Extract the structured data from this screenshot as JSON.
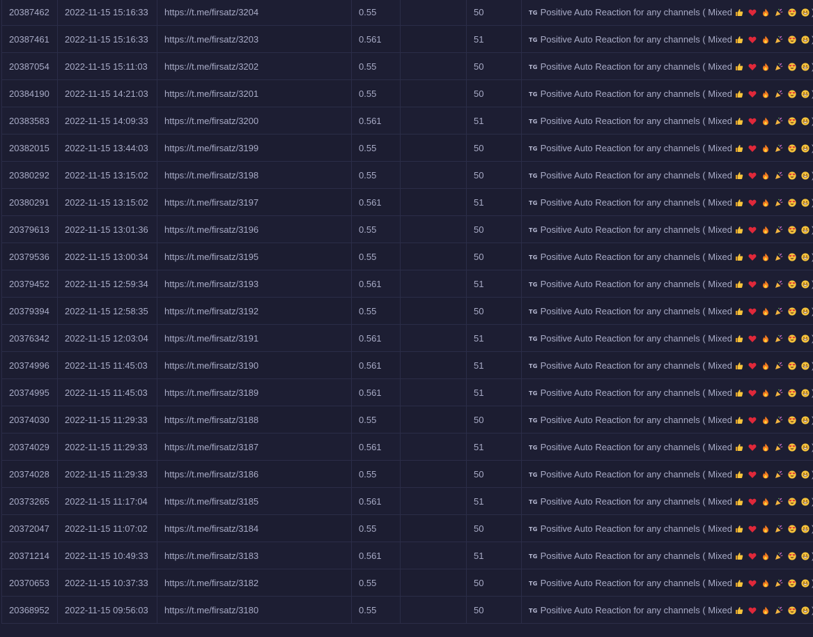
{
  "service_badge": "TG",
  "service_text": "Positive Auto Reaction for any channels ( Mixed",
  "service_close": ")",
  "emoji_icons": [
    "thumbs-up-icon",
    "heart-icon",
    "fire-icon",
    "party-popper-icon",
    "heart-eyes-icon",
    "grin-icon"
  ],
  "rows": [
    {
      "id": "20387462",
      "date": "2022-11-15 15:16:33",
      "link": "https://t.me/firsatz/3204",
      "charge": "0.55",
      "start_count": "",
      "quantity": "50"
    },
    {
      "id": "20387461",
      "date": "2022-11-15 15:16:33",
      "link": "https://t.me/firsatz/3203",
      "charge": "0.561",
      "start_count": "",
      "quantity": "51"
    },
    {
      "id": "20387054",
      "date": "2022-11-15 15:11:03",
      "link": "https://t.me/firsatz/3202",
      "charge": "0.55",
      "start_count": "",
      "quantity": "50"
    },
    {
      "id": "20384190",
      "date": "2022-11-15 14:21:03",
      "link": "https://t.me/firsatz/3201",
      "charge": "0.55",
      "start_count": "",
      "quantity": "50"
    },
    {
      "id": "20383583",
      "date": "2022-11-15 14:09:33",
      "link": "https://t.me/firsatz/3200",
      "charge": "0.561",
      "start_count": "",
      "quantity": "51"
    },
    {
      "id": "20382015",
      "date": "2022-11-15 13:44:03",
      "link": "https://t.me/firsatz/3199",
      "charge": "0.55",
      "start_count": "",
      "quantity": "50"
    },
    {
      "id": "20380292",
      "date": "2022-11-15 13:15:02",
      "link": "https://t.me/firsatz/3198",
      "charge": "0.55",
      "start_count": "",
      "quantity": "50"
    },
    {
      "id": "20380291",
      "date": "2022-11-15 13:15:02",
      "link": "https://t.me/firsatz/3197",
      "charge": "0.561",
      "start_count": "",
      "quantity": "51"
    },
    {
      "id": "20379613",
      "date": "2022-11-15 13:01:36",
      "link": "https://t.me/firsatz/3196",
      "charge": "0.55",
      "start_count": "",
      "quantity": "50"
    },
    {
      "id": "20379536",
      "date": "2022-11-15 13:00:34",
      "link": "https://t.me/firsatz/3195",
      "charge": "0.55",
      "start_count": "",
      "quantity": "50"
    },
    {
      "id": "20379452",
      "date": "2022-11-15 12:59:34",
      "link": "https://t.me/firsatz/3193",
      "charge": "0.561",
      "start_count": "",
      "quantity": "51"
    },
    {
      "id": "20379394",
      "date": "2022-11-15 12:58:35",
      "link": "https://t.me/firsatz/3192",
      "charge": "0.55",
      "start_count": "",
      "quantity": "50"
    },
    {
      "id": "20376342",
      "date": "2022-11-15 12:03:04",
      "link": "https://t.me/firsatz/3191",
      "charge": "0.561",
      "start_count": "",
      "quantity": "51"
    },
    {
      "id": "20374996",
      "date": "2022-11-15 11:45:03",
      "link": "https://t.me/firsatz/3190",
      "charge": "0.561",
      "start_count": "",
      "quantity": "51"
    },
    {
      "id": "20374995",
      "date": "2022-11-15 11:45:03",
      "link": "https://t.me/firsatz/3189",
      "charge": "0.561",
      "start_count": "",
      "quantity": "51"
    },
    {
      "id": "20374030",
      "date": "2022-11-15 11:29:33",
      "link": "https://t.me/firsatz/3188",
      "charge": "0.55",
      "start_count": "",
      "quantity": "50"
    },
    {
      "id": "20374029",
      "date": "2022-11-15 11:29:33",
      "link": "https://t.me/firsatz/3187",
      "charge": "0.561",
      "start_count": "",
      "quantity": "51"
    },
    {
      "id": "20374028",
      "date": "2022-11-15 11:29:33",
      "link": "https://t.me/firsatz/3186",
      "charge": "0.55",
      "start_count": "",
      "quantity": "50"
    },
    {
      "id": "20373265",
      "date": "2022-11-15 11:17:04",
      "link": "https://t.me/firsatz/3185",
      "charge": "0.561",
      "start_count": "",
      "quantity": "51"
    },
    {
      "id": "20372047",
      "date": "2022-11-15 11:07:02",
      "link": "https://t.me/firsatz/3184",
      "charge": "0.55",
      "start_count": "",
      "quantity": "50"
    },
    {
      "id": "20371214",
      "date": "2022-11-15 10:49:33",
      "link": "https://t.me/firsatz/3183",
      "charge": "0.561",
      "start_count": "",
      "quantity": "51"
    },
    {
      "id": "20370653",
      "date": "2022-11-15 10:37:33",
      "link": "https://t.me/firsatz/3182",
      "charge": "0.55",
      "start_count": "",
      "quantity": "50"
    },
    {
      "id": "20368952",
      "date": "2022-11-15 09:56:03",
      "link": "https://t.me/firsatz/3180",
      "charge": "0.55",
      "start_count": "",
      "quantity": "50"
    }
  ]
}
